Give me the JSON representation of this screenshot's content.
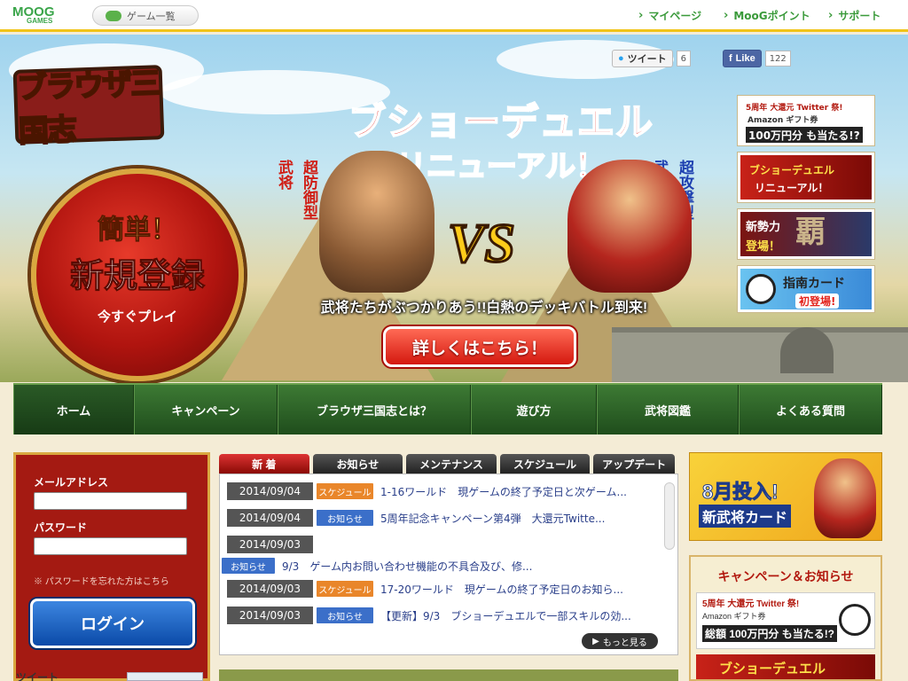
{
  "topbar": {
    "logo_main": "MOOG",
    "logo_sub": "GAMES",
    "game_list": "ゲーム一覧",
    "links": [
      "マイページ",
      "MooGポイント",
      "サポート"
    ]
  },
  "social": {
    "tweet_label": "ツイート",
    "tweet_count": "6",
    "like_label": "Like",
    "like_count": "122"
  },
  "hero": {
    "game_logo": "ブラウザ三国志",
    "register": {
      "line1": "簡単！",
      "line2": "新規登録",
      "line3": "今すぐプレイ"
    },
    "title": "ブショーデュエル",
    "subtitle": "リニューアル！",
    "left_type": "超防御型",
    "left_tag": "武将",
    "right_type": "超攻撃型",
    "right_tag": "武将",
    "vs": "VS",
    "tagline": "武将たちがぶつかりあう!!白熱のデッキバトル到来!",
    "detail_button": "詳しくはこちら！"
  },
  "side_banners": [
    {
      "line1": "5周年 大還元 Twitter 祭!",
      "line2": "Amazon ギフト券",
      "line3": "100万円分 も当たる!?"
    },
    {
      "line1": "ブショーデュエル",
      "line2": "リニューアル！"
    },
    {
      "line1": "新勢力",
      "line2": "登場！",
      "line3": "覇"
    },
    {
      "line1": "指南カード",
      "line2": "初登場!"
    }
  ],
  "nav": [
    "ホーム",
    "キャンペーン",
    "ブラウザ三国志とは？",
    "遊び方",
    "武将図鑑",
    "よくある質問"
  ],
  "login": {
    "email_label": "メールアドレス",
    "password_label": "パスワード",
    "forgot": "※ パスワードを忘れた方はこちら",
    "button": "ログイン"
  },
  "news": {
    "tabs": [
      "新 着",
      "お知らせ",
      "メンテナンス",
      "スケジュール",
      "アップデート"
    ],
    "items": [
      {
        "date": "2014/09/04",
        "category": "スケジュール",
        "title": "1-16ワールド　現ゲームの終了予定日と次ゲーム..."
      },
      {
        "date": "2014/09/04",
        "category": "お知らせ",
        "title": "5周年記念キャンペーン第4弾　大還元Twitte..."
      },
      {
        "date": "2014/09/03",
        "category": "",
        "title": ""
      },
      {
        "date": "",
        "category": "お知らせ",
        "title": "9/3　ゲーム内お問い合わせ機能の不具合及び、修..."
      },
      {
        "date": "2014/09/03",
        "category": "スケジュール",
        "title": "17-20ワールド　現ゲームの終了予定日のお知ら..."
      },
      {
        "date": "2014/09/03",
        "category": "お知らせ",
        "title": "【更新】9/3　ブショーデュエルで一部スキルの効..."
      }
    ],
    "more": "もっと見る"
  },
  "right": {
    "new_busho": {
      "line1": "8月投入!",
      "line2": "新武将カード"
    },
    "campaign_heading": "キャンペーン＆お知らせ",
    "campaign_banner": {
      "line1": "5周年 大還元 Twitter 祭!",
      "line2": "Amazon ギフト券",
      "line3": "総額 100万円分 も当たる!?"
    },
    "campaign_banner2": "ブショーデュエル"
  },
  "bottom": {
    "tweet": "ツイート"
  },
  "colors": {
    "accent_red": "#b0140f",
    "nav_green": "#2a5a26",
    "link_green": "#3a9a3a",
    "schedule": "#e9862a",
    "notice": "#3b6fc9"
  }
}
